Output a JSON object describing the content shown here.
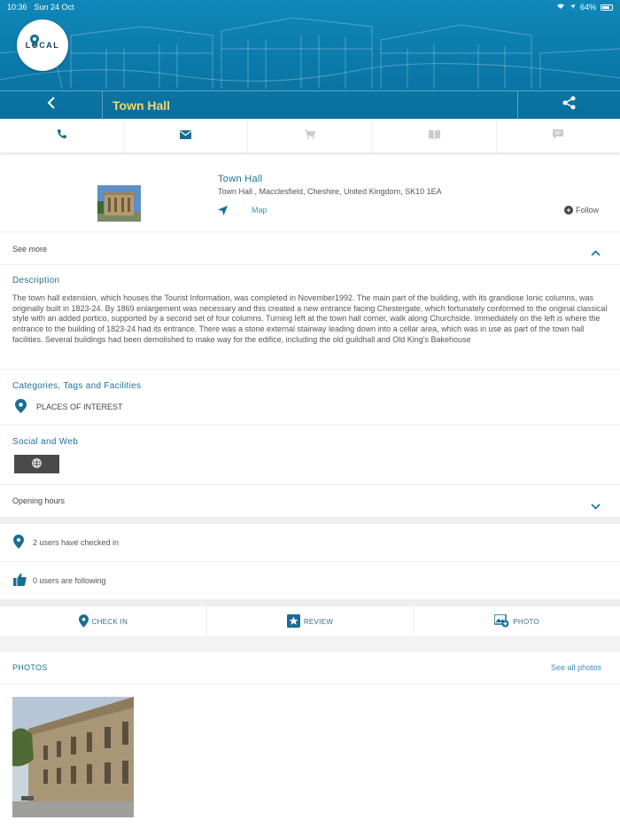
{
  "status_bar": {
    "time": "10:36",
    "date": "Sun 24 Oct",
    "battery": "64%"
  },
  "app": {
    "logo_text": "LOCAL",
    "header_title": "Town Hall"
  },
  "contact_bar": {
    "items": [
      "phone-icon",
      "email-icon",
      "cart-icon",
      "book-icon",
      "chat-icon"
    ]
  },
  "place": {
    "name": "Town Hall",
    "address": "Town Hall , Macclesfield, Cheshire, United Kingdom, SK10 1EA",
    "map_label": "Map",
    "follow_label": "Follow"
  },
  "see_more": {
    "label": "See more"
  },
  "description": {
    "title": "Description",
    "body": "The town hall extension, which houses the Tourist Information, was completed in November1992. The main part of the building, with its grandiose Ionic columns, was originally built in 1823-24. By 1869 enlargement was necessary and this created a new entrance facing Chestergate, which fortunately conformed to the original classical style with an added portico, supported by a second set of four columns. Turning left at the town hall corner, walk along Churchside. Immediately on the left is where the entrance to the building of 1823-24 had its entrance. There was a stone external stairway leading down into a cellar area, which was in use as part of the town hall facilities. Several buildings had been demolished to make way for the edifice, including the old guildhall and Old King's Bakehouse"
  },
  "categories": {
    "title": "Categories, Tags and Facilities",
    "items": [
      "PLACES OF INTEREST"
    ]
  },
  "social": {
    "title": "Social and Web"
  },
  "opening_hours": {
    "label": "Opening hours"
  },
  "stats": {
    "checked_in": "2 users have checked in",
    "following": "0 users are following"
  },
  "actions": {
    "check_in": "CHECK IN",
    "review": "REVIEW",
    "photo": "PHOTO"
  },
  "photos": {
    "title": "PHOTOS",
    "see_all": "See all photos"
  },
  "colors": {
    "header_blue": "#0a78a8",
    "title_yellow": "#f5d66a",
    "accent_blue": "#1f6f98",
    "link_blue": "#3b8fbf"
  }
}
